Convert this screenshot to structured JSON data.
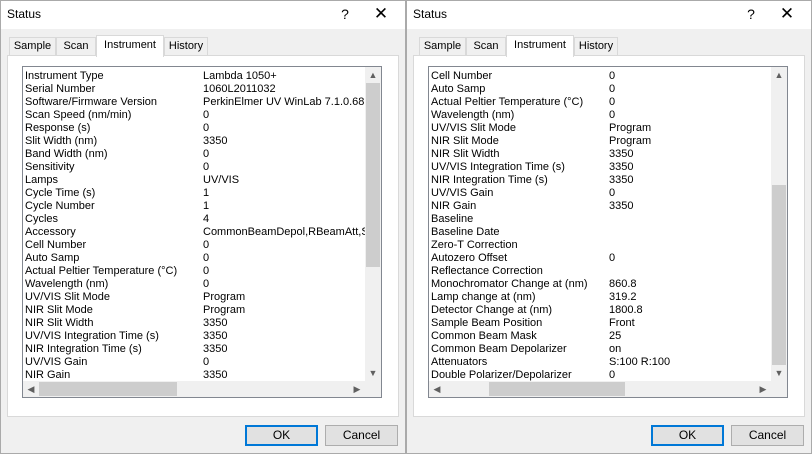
{
  "left_dialog": {
    "title": "Status",
    "help_glyph": "?",
    "close_glyph": "✕",
    "tabs": [
      {
        "label": "Sample"
      },
      {
        "label": "Scan"
      },
      {
        "label": "Instrument"
      },
      {
        "label": "History"
      }
    ],
    "active_tab": "Instrument",
    "rows": [
      {
        "label": "Instrument Type",
        "value": "Lambda 1050+"
      },
      {
        "label": "Serial Number",
        "value": "1060L2011032"
      },
      {
        "label": "Software/Firmware Version",
        "value": "PerkinElmer UV WinLab 7.1.0.68 /"
      },
      {
        "label": "Scan Speed (nm/min)",
        "value": "0"
      },
      {
        "label": "Response (s)",
        "value": "0"
      },
      {
        "label": "Slit Width (nm)",
        "value": "3350"
      },
      {
        "label": "Band Width (nm)",
        "value": "0"
      },
      {
        "label": "Sensitivity",
        "value": "0"
      },
      {
        "label": "Lamps",
        "value": "UV/VIS"
      },
      {
        "label": "Cycle Time (s)",
        "value": "1"
      },
      {
        "label": "Cycle Number",
        "value": "1"
      },
      {
        "label": "Cycles",
        "value": "4"
      },
      {
        "label": "Accessory",
        "value": "CommonBeamDepol,RBeamAtt,SB"
      },
      {
        "label": "Cell Number",
        "value": "0"
      },
      {
        "label": "Auto Samp",
        "value": "0"
      },
      {
        "label": "Actual Peltier Temperature (°C)",
        "value": "0"
      },
      {
        "label": "Wavelength (nm)",
        "value": "0"
      },
      {
        "label": "UV/VIS Slit Mode",
        "value": "Program"
      },
      {
        "label": "NIR Slit Mode",
        "value": "Program"
      },
      {
        "label": "NIR Slit Width",
        "value": "3350"
      },
      {
        "label": "UV/VIS Integration Time (s)",
        "value": "3350"
      },
      {
        "label": "NIR Integration Time (s)",
        "value": "3350"
      },
      {
        "label": "UV/VIS Gain",
        "value": "0"
      },
      {
        "label": "NIR Gain",
        "value": "3350"
      }
    ],
    "ok_label": "OK",
    "cancel_label": "Cancel"
  },
  "right_dialog": {
    "title": "Status",
    "help_glyph": "?",
    "close_glyph": "✕",
    "tabs": [
      {
        "label": "Sample"
      },
      {
        "label": "Scan"
      },
      {
        "label": "Instrument"
      },
      {
        "label": "History"
      }
    ],
    "active_tab": "Instrument",
    "rows": [
      {
        "label": "Cell Number",
        "value": "0"
      },
      {
        "label": "Auto Samp",
        "value": "0"
      },
      {
        "label": "Actual Peltier Temperature (°C)",
        "value": "0"
      },
      {
        "label": "Wavelength (nm)",
        "value": "0"
      },
      {
        "label": "UV/VIS Slit Mode",
        "value": "Program"
      },
      {
        "label": "NIR Slit Mode",
        "value": "Program"
      },
      {
        "label": "NIR Slit Width",
        "value": "3350"
      },
      {
        "label": "UV/VIS Integration Time (s)",
        "value": "3350"
      },
      {
        "label": "NIR Integration Time (s)",
        "value": "3350"
      },
      {
        "label": "UV/VIS Gain",
        "value": "0"
      },
      {
        "label": "NIR Gain",
        "value": "3350"
      },
      {
        "label": "Baseline",
        "value": ""
      },
      {
        "label": "Baseline Date",
        "value": ""
      },
      {
        "label": "Zero-T Correction",
        "value": ""
      },
      {
        "label": "Autozero Offset",
        "value": "0"
      },
      {
        "label": "Reflectance Correction",
        "value": ""
      },
      {
        "label": "Monochromator Change at (nm)",
        "value": "860.8"
      },
      {
        "label": "Lamp change at (nm)",
        "value": "319.2"
      },
      {
        "label": "Detector Change at (nm)",
        "value": "1800.8"
      },
      {
        "label": "Sample Beam Position",
        "value": "Front"
      },
      {
        "label": "Common Beam Mask",
        "value": "25"
      },
      {
        "label": "Common Beam Depolarizer",
        "value": "on"
      },
      {
        "label": "Attenuators",
        "value": "S:100 R:100"
      },
      {
        "label": "Double Polarizer/Depolarizer",
        "value": "0"
      }
    ],
    "ok_label": "OK",
    "cancel_label": "Cancel"
  },
  "icons": {
    "scroll_up": "▲",
    "scroll_down": "▼",
    "scroll_left": "◀",
    "scroll_right": "▶"
  },
  "colors": {
    "default_button_border": "#0078d7",
    "dialog_background": "#f0f0f0",
    "scroll_thumb": "#cdcdcd"
  }
}
